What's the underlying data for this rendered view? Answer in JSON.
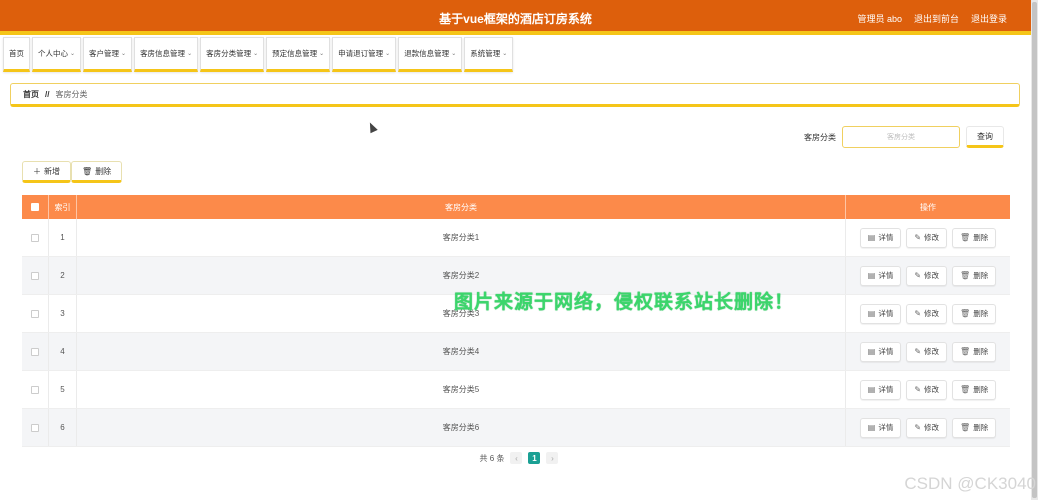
{
  "header": {
    "title": "基于vue框架的酒店订房系统",
    "admin": "管理员 abo",
    "exit_front": "退出到前台",
    "logout": "退出登录"
  },
  "nav": [
    {
      "label": "首页",
      "dropdown": false
    },
    {
      "label": "个人中心",
      "dropdown": true
    },
    {
      "label": "客户管理",
      "dropdown": true
    },
    {
      "label": "客房信息管理",
      "dropdown": true
    },
    {
      "label": "客房分类管理",
      "dropdown": true
    },
    {
      "label": "预定信息管理",
      "dropdown": true
    },
    {
      "label": "申请退订管理",
      "dropdown": true
    },
    {
      "label": "退款信息管理",
      "dropdown": true
    },
    {
      "label": "系统管理",
      "dropdown": true
    }
  ],
  "breadcrumb": {
    "home": "首页",
    "separator": "//",
    "current": "客房分类"
  },
  "search": {
    "label": "客房分类",
    "placeholder": "客房分类",
    "button": "查询"
  },
  "actions": {
    "add": "新增",
    "delete": "删除"
  },
  "table": {
    "headers": {
      "index": "索引",
      "name": "客房分类",
      "ops": "操作"
    },
    "op_labels": {
      "detail": "详情",
      "edit": "修改",
      "delete": "删除"
    },
    "rows": [
      {
        "index": "1",
        "name": "客房分类1"
      },
      {
        "index": "2",
        "name": "客房分类2"
      },
      {
        "index": "3",
        "name": "客房分类3"
      },
      {
        "index": "4",
        "name": "客房分类4"
      },
      {
        "index": "5",
        "name": "客房分类5"
      },
      {
        "index": "6",
        "name": "客房分类6"
      }
    ]
  },
  "pager": {
    "total": "共 6 条",
    "current_page": "1",
    "prev": "‹",
    "next": "›"
  },
  "watermark": "图片来源于网络，侵权联系站长删除！",
  "csdn": "CSDN @CK3040",
  "colors": {
    "header": "#dd5f0c",
    "accent": "#f5c518",
    "table_head": "#fc8a4a",
    "page_active": "#1aa094",
    "watermark": "#3bd66b"
  }
}
